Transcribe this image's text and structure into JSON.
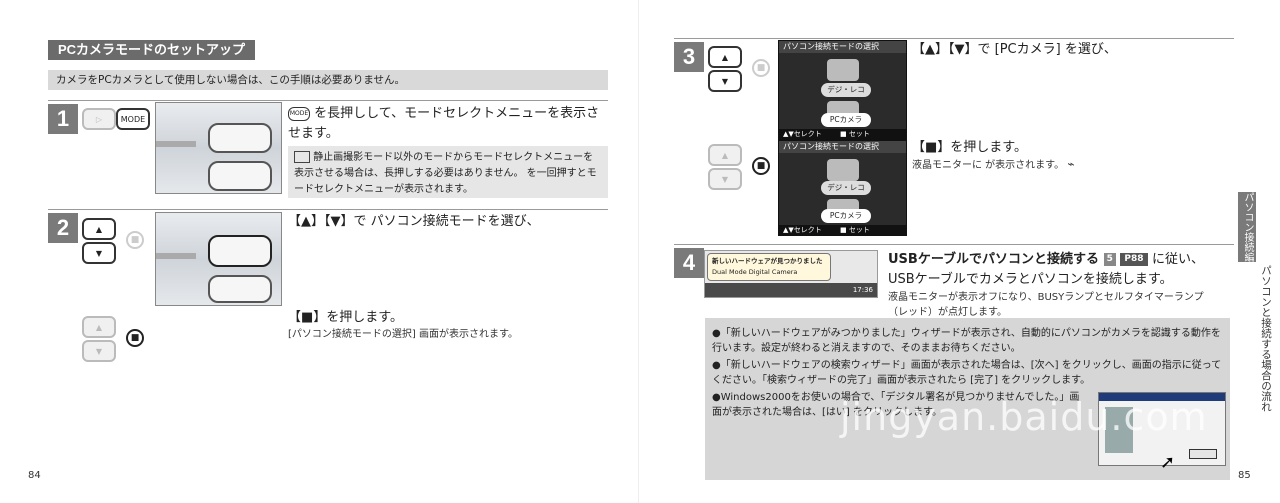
{
  "left_page": {
    "section_title": "PCカメラモードのセットアップ",
    "note": "カメラをPCカメラとして使用しない場合は、この手順は必要ありません。",
    "step1": {
      "num": "1",
      "mode_btn": "MODE",
      "text": "を長押しして、モードセレクトメニューを表示させます。",
      "sub": "静止画撮影モード以外のモードからモードセレクトメニューを表示させる場合は、長押しする必要はありません。 を一回押すとモードセレクトメニューが表示されます。"
    },
    "step2": {
      "num": "2",
      "text": "【▲】【▼】で パソコン接続モードを選び、",
      "text2": "【■】を押します。",
      "sub": "[パソコン接続モードの選択] 画面が表示されます。"
    },
    "page_number": "84"
  },
  "right_page": {
    "step3": {
      "num": "3",
      "text": "【▲】【▼】で [PCカメラ] を選び、",
      "text2": "【■】を押します。",
      "sub": "液晶モニターに が表示されます。",
      "screen_title": "パソコン接続モードの選択",
      "menu_digicam": "デジ・レコ",
      "menu_pccam": "PCカメラ",
      "status_select": "▲▼セレクト",
      "status_set": "■ セット"
    },
    "step4": {
      "num": "4",
      "title": "USBケーブルでパソコンと接続する",
      "ref_num": "5",
      "ref_page": "P88",
      "title_after": "に従い、",
      "line2": "USBケーブルでカメラとパソコンを接続します。",
      "sub": "液晶モニターが表示オフになり、BUSYランプとセルフタイマーランプ（レッド）が点灯します。",
      "balloon_title": "新しいハードウェアが見つかりました",
      "balloon_body": "Dual Mode Digital Camera",
      "clock": "17:36"
    },
    "bullets": [
      "「新しいハードウェアがみつかりました」ウィザードが表示され、自動的にパソコンがカメラを認識する動作を行います。設定が終わると消えますので、そのままお待ちください。",
      "「新しいハードウェアの検索ウィザード」画面が表示された場合は、[次へ] をクリックし、画面の指示に従ってください。「検索ウィザードの完了」画面が表示されたら [完了] をクリックします。",
      "Windows2000をお使いの場合で、「デジタル署名が見つかりませんでした。」画面が表示された場合は、[はい] をクリックします。"
    ],
    "side_tab": "パソコン接続編",
    "side_text": "パソコンと接続する場合の流れ",
    "page_number": "85",
    "watermark": "jingyan.baidu.com"
  },
  "colors": {
    "step_bg": "#7a7a7a",
    "section_bg": "#6b6b6b",
    "note_bg": "#d9d9d9",
    "info_bg": "#d6d6d6"
  }
}
